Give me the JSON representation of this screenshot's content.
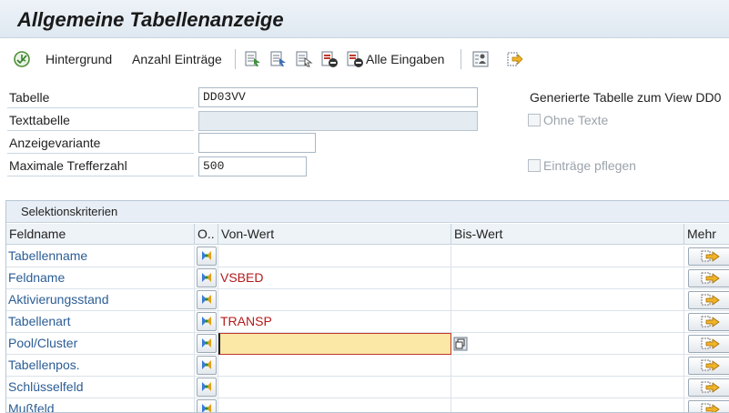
{
  "window": {
    "title": "Allgemeine Tabellenanzeige"
  },
  "toolbar": {
    "execute_icon": "execute-clock-icon",
    "background_label": "Hintergrund",
    "count_label": "Anzahl Einträge",
    "all_inputs_label": "Alle Eingaben"
  },
  "form": {
    "table_label": "Tabelle",
    "table_value": "DD03VV",
    "text_table_label": "Texttabelle",
    "text_table_value": "",
    "variant_label": "Anzeigevariante",
    "variant_value": "",
    "max_hits_label": "Maximale Trefferzahl",
    "max_hits_value": "500",
    "generated_text": "Generierte Tabelle zum View DD0",
    "without_texts_label": "Ohne Texte",
    "maintain_entries_label": "Einträge pflegen"
  },
  "grid": {
    "title": "Selektionskriterien",
    "headers": {
      "field": "Feldname",
      "op": "O..",
      "from": "Von-Wert",
      "to": "Bis-Wert",
      "more": "Mehr"
    },
    "rows": [
      {
        "field": "Tabellenname",
        "from": ""
      },
      {
        "field": "Feldname",
        "from": "VSBED"
      },
      {
        "field": "Aktivierungsstand",
        "from": ""
      },
      {
        "field": "Tabellenart",
        "from": "TRANSP"
      },
      {
        "field": "Pool/Cluster",
        "from": ""
      },
      {
        "field": "Tabellenpos.",
        "from": ""
      },
      {
        "field": "Schlüsselfeld",
        "from": ""
      },
      {
        "field": "Mußfeld",
        "from": ""
      }
    ]
  },
  "colors": {
    "field_link": "#2b5d94",
    "value_red": "#b31b1b",
    "active_input": "#fbe7a6"
  }
}
